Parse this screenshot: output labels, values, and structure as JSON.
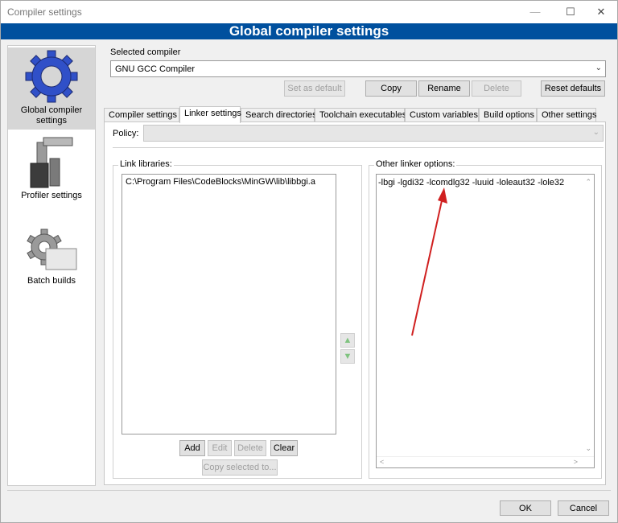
{
  "window": {
    "title": "Compiler settings",
    "min_icon": "—",
    "max_icon": "☐",
    "close_icon": "✕"
  },
  "banner": {
    "title": "Global compiler settings"
  },
  "sidebar": {
    "items": [
      {
        "label": "Global compiler settings",
        "icon": "gear-icon",
        "selected": true
      },
      {
        "label": "Profiler settings",
        "icon": "profiler-icon",
        "selected": false
      },
      {
        "label": "Batch builds",
        "icon": "batch-icon",
        "selected": false
      }
    ]
  },
  "compiler": {
    "label": "Selected compiler",
    "value": "GNU GCC Compiler",
    "buttons": {
      "set_default": "Set as default",
      "copy": "Copy",
      "rename": "Rename",
      "delete": "Delete",
      "reset": "Reset defaults"
    }
  },
  "tabs": [
    {
      "label": "Compiler settings",
      "active": false
    },
    {
      "label": "Linker settings",
      "active": true
    },
    {
      "label": "Search directories",
      "active": false
    },
    {
      "label": "Toolchain executables",
      "active": false
    },
    {
      "label": "Custom variables",
      "active": false
    },
    {
      "label": "Build options",
      "active": false
    },
    {
      "label": "Other settings",
      "active": false
    }
  ],
  "linker": {
    "policy_label": "Policy:",
    "policy_value": "",
    "link_libraries": {
      "title": "Link libraries:",
      "items": [
        "C:\\Program Files\\CodeBlocks\\MinGW\\lib\\libbgi.a"
      ],
      "buttons": {
        "add": "Add",
        "edit": "Edit",
        "delete": "Delete",
        "clear": "Clear",
        "copy_selected": "Copy selected to..."
      }
    },
    "move_up_icon": "▲",
    "move_down_icon": "▼",
    "other_options": {
      "title": "Other linker options:",
      "value": "-lbgi -lgdi32 -lcomdlg32 -luuid -loleaut32 -lole32"
    }
  },
  "footer": {
    "ok": "OK",
    "cancel": "Cancel"
  },
  "colors": {
    "banner": "#00509e",
    "annotation_arrow": "#d02020"
  }
}
